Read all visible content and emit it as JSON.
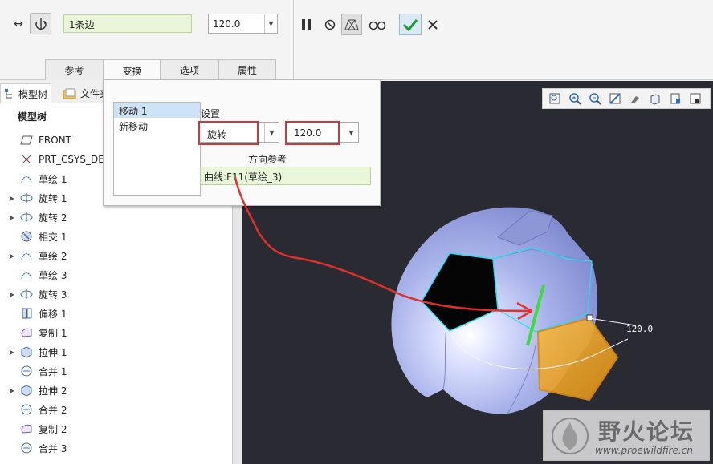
{
  "dashboard": {
    "edge_collector": "1条边",
    "value": "120.0",
    "tabs": [
      "参考",
      "变换",
      "选项",
      "属性"
    ]
  },
  "tree": {
    "tabs": [
      "模型树",
      "文件夹"
    ],
    "header": "模型树",
    "items": [
      {
        "label": "FRONT",
        "icon": "datum-plane-icon",
        "expandable": false
      },
      {
        "label": "PRT_CSYS_DEF",
        "icon": "csys-icon",
        "expandable": false
      },
      {
        "label": "草绘 1",
        "icon": "sketch-icon",
        "expandable": false
      },
      {
        "label": "旋转 1",
        "icon": "revolve-icon",
        "expandable": true
      },
      {
        "label": "旋转 2",
        "icon": "revolve-icon",
        "expandable": true
      },
      {
        "label": "相交 1",
        "icon": "intersect-icon",
        "expandable": false
      },
      {
        "label": "草绘 2",
        "icon": "sketch-icon",
        "expandable": true
      },
      {
        "label": "草绘 3",
        "icon": "sketch-icon",
        "expandable": false
      },
      {
        "label": "旋转 3",
        "icon": "revolve-icon",
        "expandable": true
      },
      {
        "label": "偏移 1",
        "icon": "offset-icon",
        "expandable": false
      },
      {
        "label": "复制 1",
        "icon": "copy-icon",
        "expandable": false
      },
      {
        "label": "拉伸 1",
        "icon": "extrude-icon",
        "expandable": true
      },
      {
        "label": "合并 1",
        "icon": "merge-icon",
        "expandable": false
      },
      {
        "label": "拉伸 2",
        "icon": "extrude-icon",
        "expandable": true
      },
      {
        "label": "合并 2",
        "icon": "merge-icon",
        "expandable": false
      },
      {
        "label": "复制 2",
        "icon": "copy-icon",
        "expandable": false
      },
      {
        "label": "合并 3",
        "icon": "merge-icon",
        "expandable": false
      }
    ]
  },
  "transform_panel": {
    "moves": [
      "移动 1",
      "新移动"
    ],
    "settings_label": "设置",
    "type_value": "旋转",
    "angle_value": "120.0",
    "direction_ref_label": "方向参考",
    "direction_ref_value": "曲线:F11(草绘_3)"
  },
  "graphics": {
    "dimension_label": "120.0"
  },
  "watermark": {
    "title": "野火论坛",
    "url": "www.proewildfire.cn"
  },
  "colors": {
    "accent_red": "#d8333a",
    "collector_green": "#eaf6d9",
    "ball_blue": "#a9b3ea",
    "patch_orange": "#f2a521"
  }
}
